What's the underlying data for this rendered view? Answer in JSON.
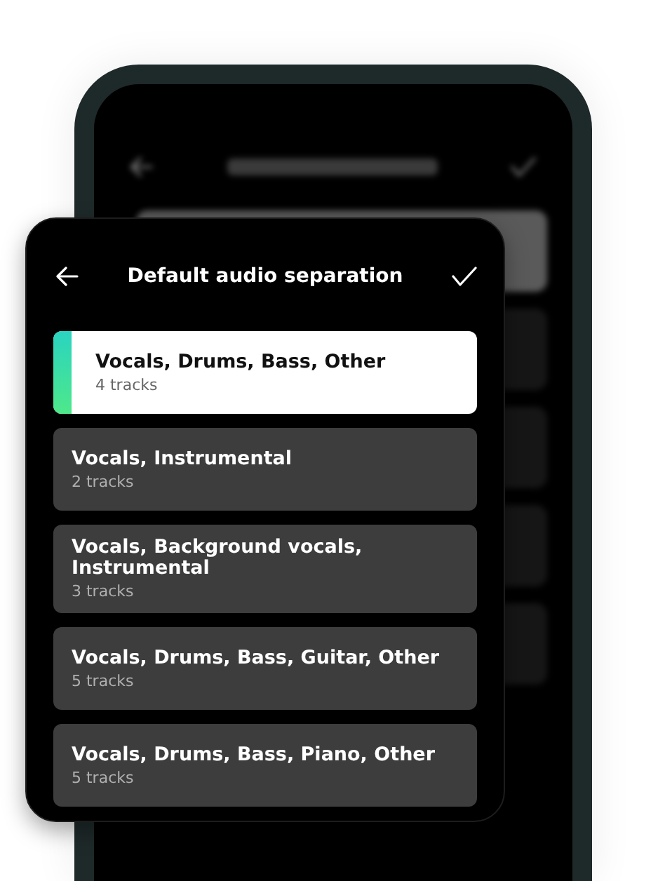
{
  "dialog": {
    "title": "Default audio separation"
  },
  "options": [
    {
      "title": "Vocals, Drums, Bass, Other",
      "subtitle": "4 tracks",
      "selected": true
    },
    {
      "title": "Vocals, Instrumental",
      "subtitle": "2 tracks",
      "selected": false
    },
    {
      "title": "Vocals, Background vocals, Instrumental",
      "subtitle": "3 tracks",
      "selected": false
    },
    {
      "title": "Vocals, Drums, Bass, Guitar, Other",
      "subtitle": "5 tracks",
      "selected": false
    },
    {
      "title": "Vocals, Drums, Bass, Piano, Other",
      "subtitle": "5 tracks",
      "selected": false
    }
  ]
}
